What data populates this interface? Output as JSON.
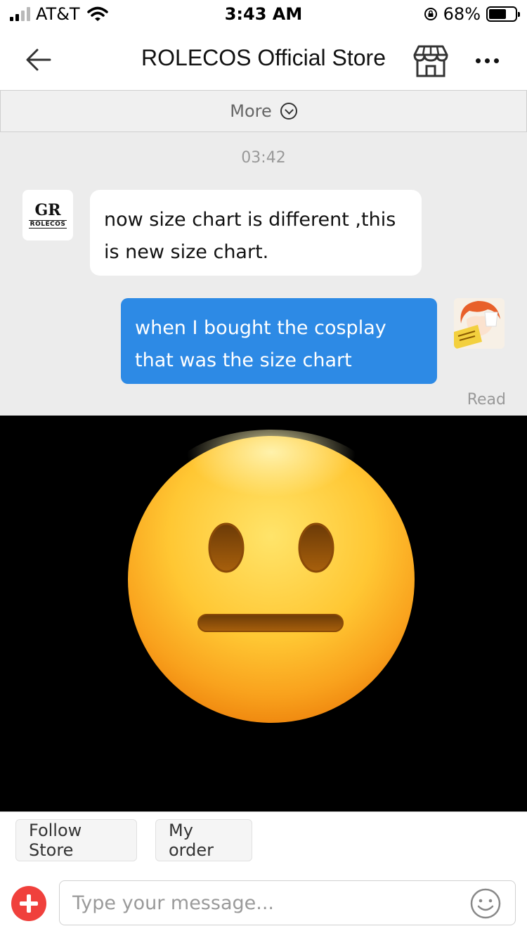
{
  "status_bar": {
    "carrier": "AT&T",
    "time": "3:43 AM",
    "battery": "68%",
    "battery_level": 0.68
  },
  "nav": {
    "title": "ROLECOS Official Store",
    "back_icon": "back-arrow-icon",
    "store_icon": "storefront-icon",
    "more_icon": "more-dots-icon"
  },
  "chat": {
    "more_label": "More",
    "timestamp": "03:42",
    "store_logo_text": "ROLECOS",
    "messages": [
      {
        "sender": "store",
        "text": "now size chart is different ,this is new size chart."
      },
      {
        "sender": "me",
        "text": "when I bought the cosplay that was the size chart",
        "status": "Read"
      }
    ],
    "image_message": {
      "icon": "neutral-face-emoji"
    }
  },
  "quick_actions": {
    "follow_store": "Follow Store",
    "my_order": "My order"
  },
  "input": {
    "placeholder": "Type your message...",
    "add_icon": "plus-icon",
    "emoji_icon": "smiley-icon"
  },
  "colors": {
    "accent_blue": "#2d8ae5",
    "add_red": "#f0403c",
    "chat_bg": "#ececec"
  }
}
